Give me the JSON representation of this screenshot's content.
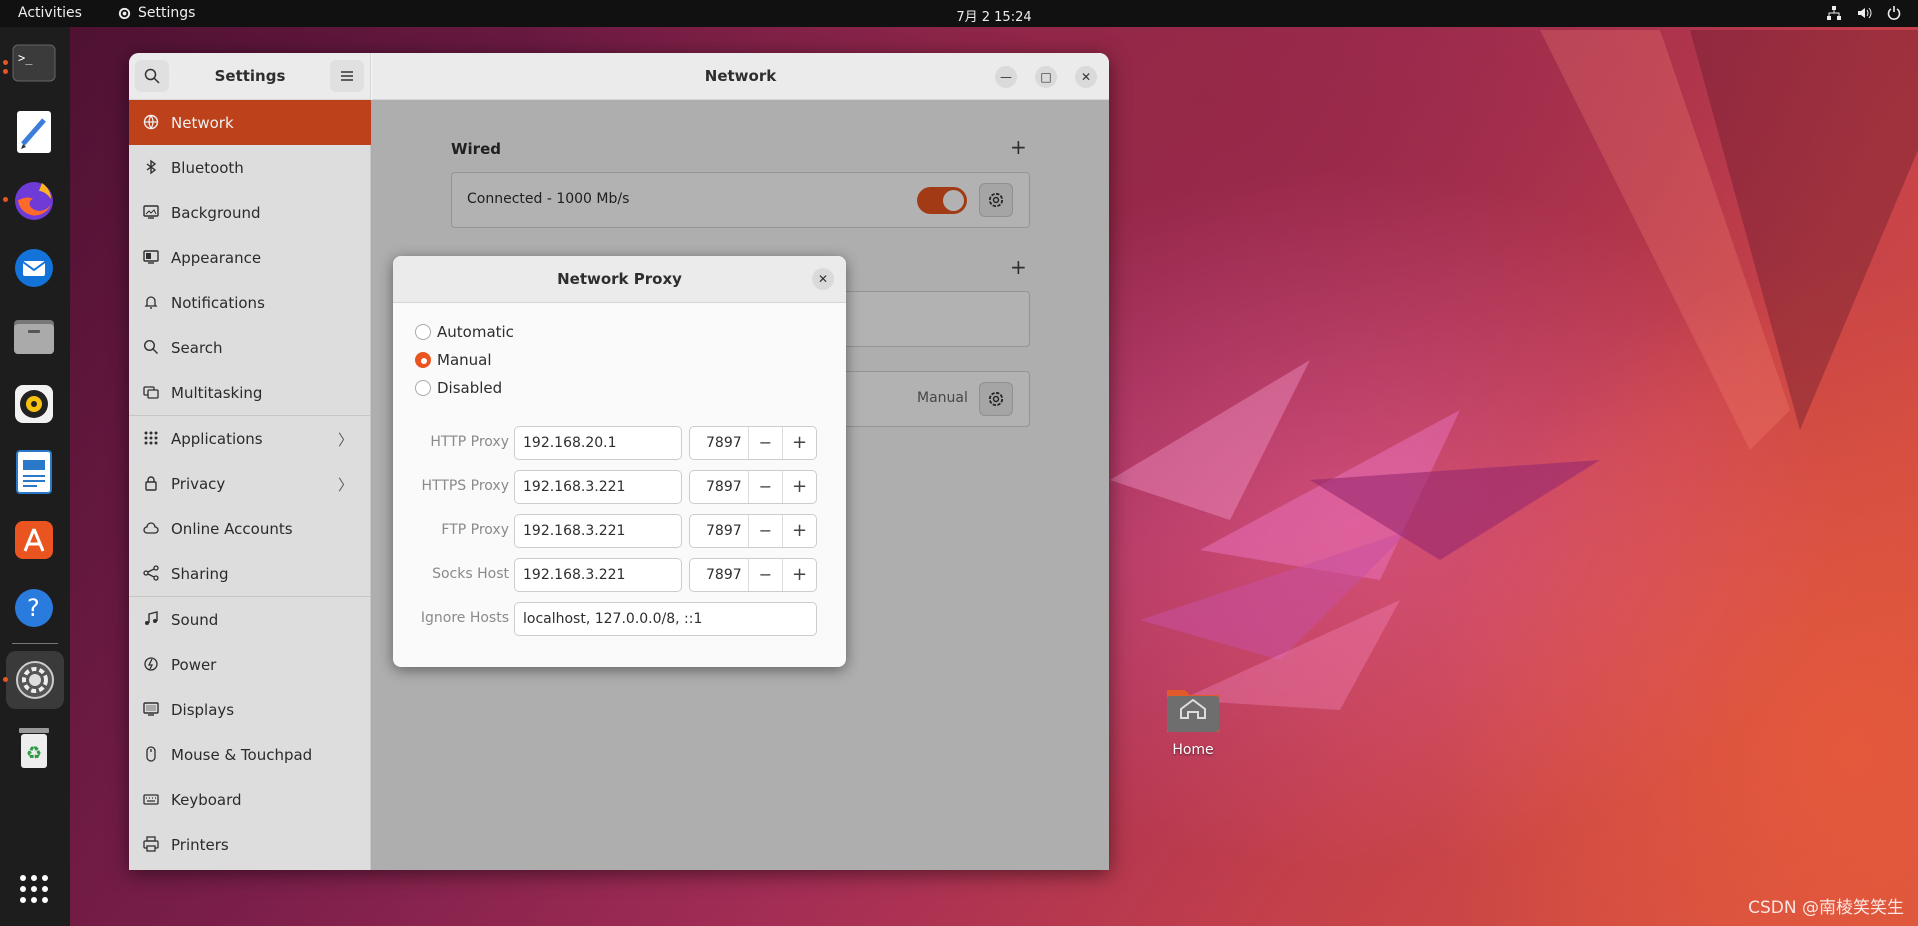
{
  "topbar": {
    "activities": "Activities",
    "app_name": "Settings",
    "clock": "7月 2  15:24"
  },
  "dock": {
    "items": [
      "terminal-icon",
      "text-editor-icon",
      "firefox-icon",
      "thunderbird-icon",
      "files-icon",
      "rhythmbox-icon",
      "writer-icon",
      "app-center-icon",
      "help-icon",
      "settings-icon",
      "trash-icon",
      "show-apps-icon"
    ]
  },
  "settings": {
    "sidebar_title": "Settings",
    "content_title": "Network",
    "sidebar_items": [
      {
        "label": "Network",
        "icon": "network-icon"
      },
      {
        "label": "Bluetooth",
        "icon": "bluetooth-icon"
      },
      {
        "label": "Background",
        "icon": "background-icon"
      },
      {
        "label": "Appearance",
        "icon": "appearance-icon"
      },
      {
        "label": "Notifications",
        "icon": "bell-icon"
      },
      {
        "label": "Search",
        "icon": "search-icon"
      },
      {
        "label": "Multitasking",
        "icon": "multitasking-icon"
      },
      {
        "label": "Applications",
        "icon": "grid-icon"
      },
      {
        "label": "Privacy",
        "icon": "lock-icon"
      },
      {
        "label": "Online Accounts",
        "icon": "cloud-icon"
      },
      {
        "label": "Sharing",
        "icon": "share-icon"
      },
      {
        "label": "Sound",
        "icon": "music-note-icon"
      },
      {
        "label": "Power",
        "icon": "power-icon"
      },
      {
        "label": "Displays",
        "icon": "display-icon"
      },
      {
        "label": "Mouse & Touchpad",
        "icon": "mouse-icon"
      },
      {
        "label": "Keyboard",
        "icon": "keyboard-icon"
      },
      {
        "label": "Printers",
        "icon": "printer-icon"
      }
    ],
    "wired": {
      "title": "Wired",
      "status": "Connected - 1000 Mb/s",
      "enabled": true
    },
    "proxy_row": {
      "value": "Manual"
    }
  },
  "dialog": {
    "title": "Network Proxy",
    "modes": [
      "Automatic",
      "Manual",
      "Disabled"
    ],
    "selected_mode": "Manual",
    "rows": [
      {
        "label": "HTTP Proxy",
        "host": "192.168.20.1",
        "port": "7897"
      },
      {
        "label": "HTTPS Proxy",
        "host": "192.168.3.221",
        "port": "7897"
      },
      {
        "label": "FTP Proxy",
        "host": "192.168.3.221",
        "port": "7897"
      },
      {
        "label": "Socks Host",
        "host": "192.168.3.221",
        "port": "7897"
      }
    ],
    "ignore_hosts": {
      "label": "Ignore Hosts",
      "value": "localhost, 127.0.0.0/8, ::1"
    }
  },
  "desktop": {
    "home_label": "Home",
    "watermark": "CSDN @南棱笑笑生"
  },
  "colors": {
    "accent": "#e95420",
    "selected_sidebar": "#c9461d"
  }
}
